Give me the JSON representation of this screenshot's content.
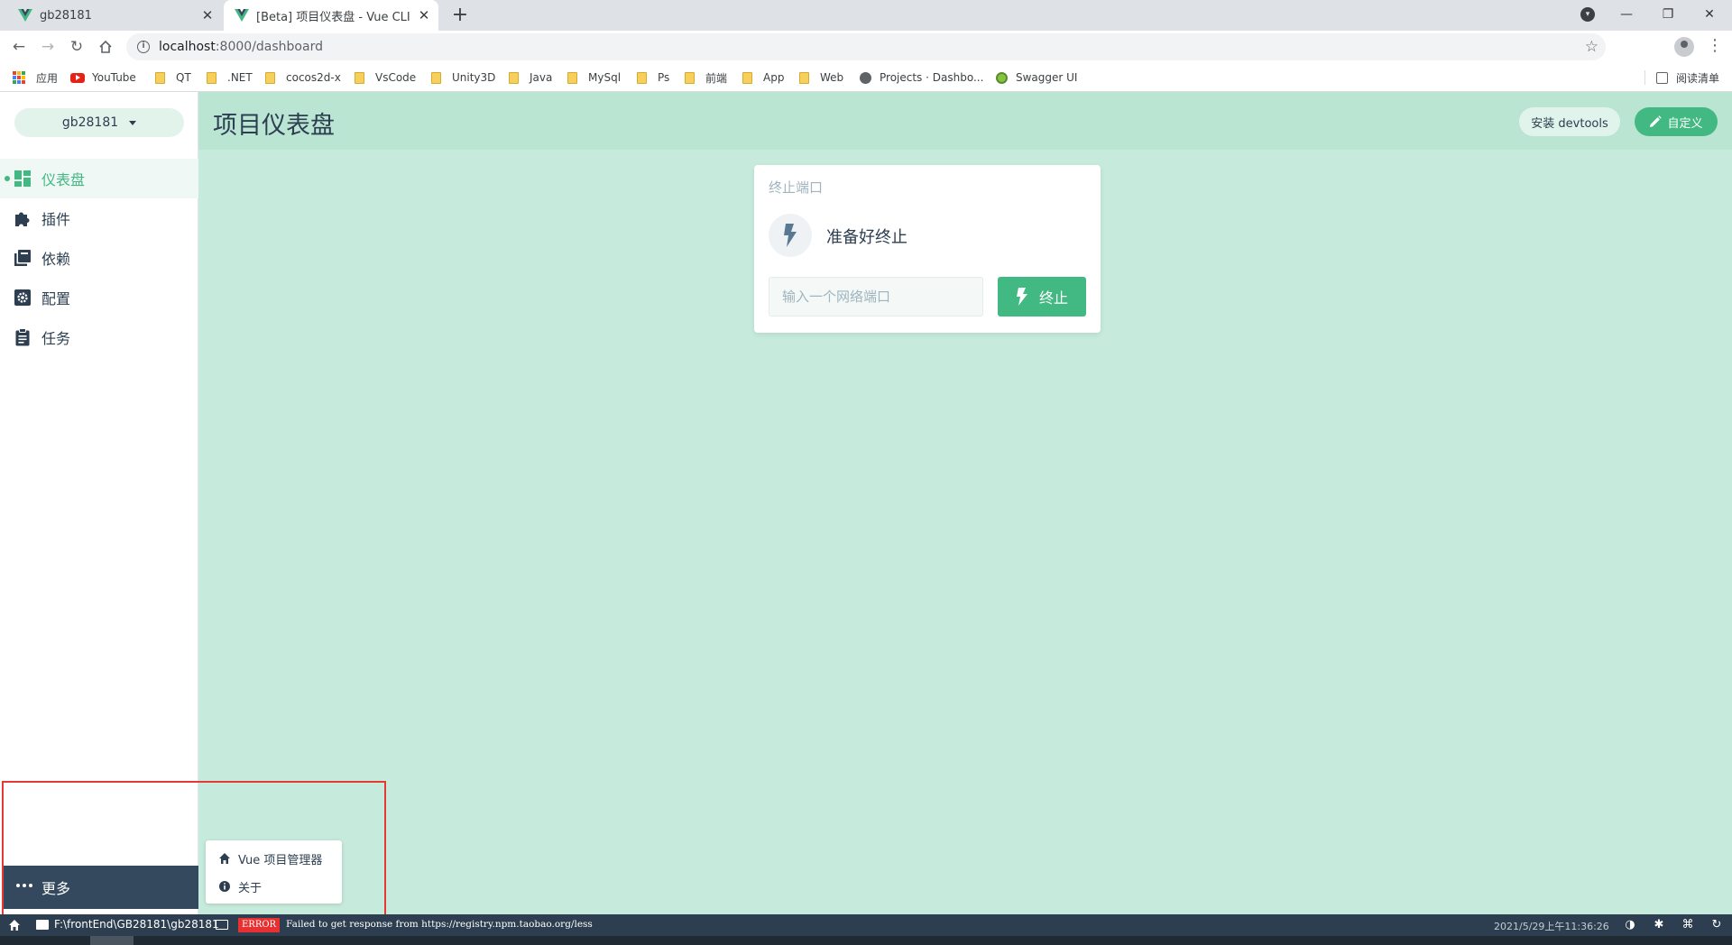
{
  "browser": {
    "tabs": [
      {
        "title": "gb28181"
      },
      {
        "title": "[Beta] 项目仪表盘 - Vue CLI"
      }
    ],
    "url_host": "localhost",
    "url_path": ":8000/dashboard",
    "bookmarks": [
      {
        "label": "应用",
        "icon": "apps-grid-icon"
      },
      {
        "label": "YouTube",
        "icon": "youtube-icon"
      },
      {
        "label": "QT",
        "icon": "folder-icon"
      },
      {
        "label": ".NET",
        "icon": "folder-icon"
      },
      {
        "label": "cocos2d-x",
        "icon": "folder-icon"
      },
      {
        "label": "VsCode",
        "icon": "folder-icon"
      },
      {
        "label": "Unity3D",
        "icon": "folder-icon"
      },
      {
        "label": "Java",
        "icon": "folder-icon"
      },
      {
        "label": "MySql",
        "icon": "folder-icon"
      },
      {
        "label": "Ps",
        "icon": "folder-icon"
      },
      {
        "label": "前端",
        "icon": "folder-icon"
      },
      {
        "label": "App",
        "icon": "folder-icon"
      },
      {
        "label": "Web",
        "icon": "folder-icon"
      },
      {
        "label": "Projects · Dashbo...",
        "icon": "globe-icon"
      },
      {
        "label": "Swagger UI",
        "icon": "swagger-icon"
      }
    ],
    "reading_list": "阅读清单"
  },
  "sidebar": {
    "project": "gb28181",
    "items": [
      {
        "label": "仪表盘",
        "icon": "dashboard-icon",
        "active": true
      },
      {
        "label": "插件",
        "icon": "puzzle-icon",
        "active": false
      },
      {
        "label": "依赖",
        "icon": "library-icon",
        "active": false
      },
      {
        "label": "配置",
        "icon": "settings-icon",
        "active": false
      },
      {
        "label": "任务",
        "icon": "clipboard-icon",
        "active": false
      }
    ],
    "more_label": "更多"
  },
  "header": {
    "title": "项目仪表盘",
    "devtools_label": "安装 devtools",
    "customize_label": "自定义"
  },
  "widget": {
    "title": "终止端口",
    "status": "准备好终止",
    "input_placeholder": "输入一个网络端口",
    "input_value": "",
    "kill_label": "终止"
  },
  "more_menu": {
    "items": [
      {
        "label": "Vue 项目管理器",
        "icon": "home-icon"
      },
      {
        "label": "关于",
        "icon": "info-icon"
      }
    ]
  },
  "statusbar": {
    "path": "F:\\frontEnd\\GB28181\\gb28181",
    "badge": "ERROR",
    "message": "Failed to get response from https://registry.npm.taobao.org/less",
    "time": "2021/5/29上午11:36:26"
  },
  "colors": {
    "accent": "#42b983",
    "sidebar_dark": "#34495e",
    "main_bg": "#c6eadb",
    "status_bg": "#2c3e50",
    "error": "#e83030"
  }
}
